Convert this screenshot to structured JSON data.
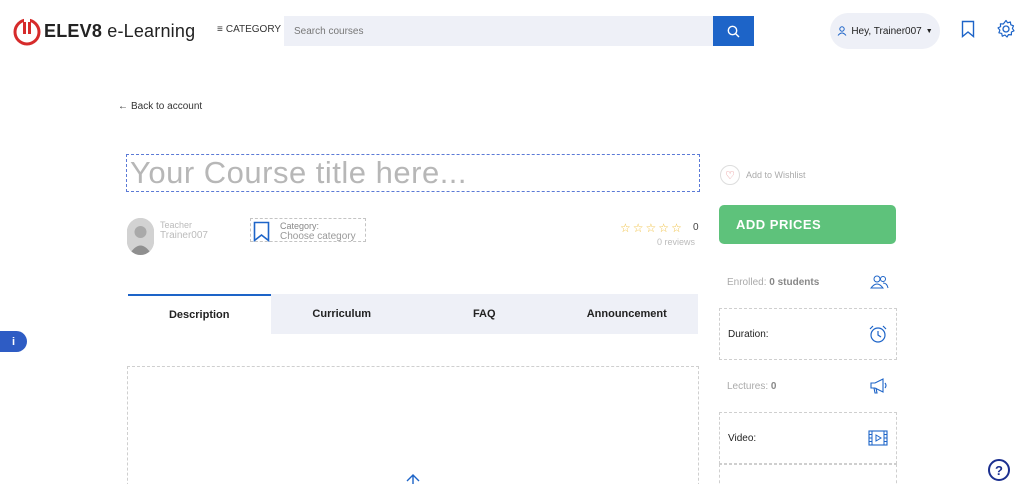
{
  "header": {
    "brand_bold": "ELEV8",
    "brand_light": " e-Learning",
    "category_label": "CATEGORY",
    "search_placeholder": "Search courses",
    "user_greeting": "Hey, Trainer007"
  },
  "back_link": "Back to account",
  "course": {
    "title_placeholder": "Your Course title here...",
    "teacher_label": "Teacher",
    "teacher_name": "Trainer007",
    "category_label": "Category:",
    "category_value": "Choose category",
    "rating_count": "0",
    "reviews": "0 reviews",
    "stars": 0
  },
  "tabs": [
    "Description",
    "Curriculum",
    "FAQ",
    "Announcement"
  ],
  "sidebar": {
    "wishlist": "Add to Wishlist",
    "add_prices": "ADD PRICES",
    "enrolled_label": "Enrolled: ",
    "enrolled_value": "0 students",
    "duration_label": "Duration:",
    "lectures_label": "Lectures: ",
    "lectures_value": "0",
    "video_label": "Video:"
  },
  "colors": {
    "accent": "#1d64c8",
    "add_prices": "#5ec27b",
    "brand_red": "#d62b2b"
  }
}
